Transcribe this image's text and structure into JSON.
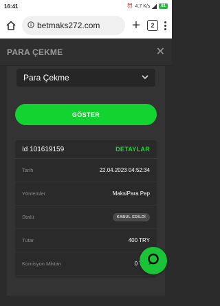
{
  "status_bar": {
    "time": "16:41",
    "speed": "4.7 K/s",
    "battery": "81"
  },
  "browser": {
    "url": "betmaks272.com",
    "tab_count": "2"
  },
  "modal": {
    "title": "PARA ÇEKME",
    "select_value": "Para Çekme",
    "show_button": "GÖSTER"
  },
  "transaction": {
    "id_label": "Id 101619159",
    "details_link": "DETAYLAR",
    "rows": [
      {
        "label": "Tarih",
        "value": "22.04.2023 04:52:34"
      },
      {
        "label": "Yöntemler",
        "value": "MaksiPara Pep"
      },
      {
        "label": "Statü",
        "value": "KABUL EDİLDİ"
      },
      {
        "label": "Tutar",
        "value": "400 TRY"
      },
      {
        "label": "Komisyon Miktarı",
        "value": "0 TRY"
      }
    ]
  },
  "colors": {
    "accent": "#12d330",
    "panel": "#333333",
    "card": "#2a2a2a"
  }
}
